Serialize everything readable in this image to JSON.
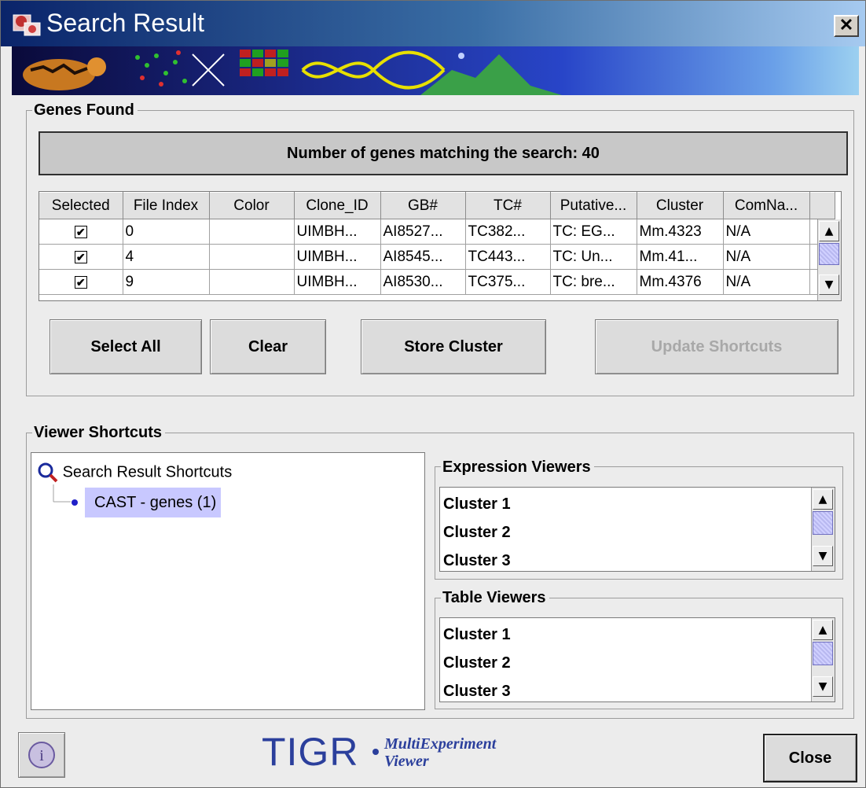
{
  "window": {
    "title": "Search Result",
    "close_glyph": "✕"
  },
  "genes_found": {
    "title": "Genes Found",
    "count_text": "Number of genes matching the search: 40",
    "columns": [
      "Selected",
      "File Index",
      "Color",
      "Clone_ID",
      "GB#",
      "TC#",
      "Putative...",
      "Cluster",
      "ComNa..."
    ],
    "rows": [
      {
        "selected": true,
        "file_index": "0",
        "color": "",
        "clone_id": "UIMBH...",
        "gb": "AI8527...",
        "tc": "TC382...",
        "putative": "TC: EG...",
        "cluster": "Mm.4323",
        "comname": "N/A"
      },
      {
        "selected": true,
        "file_index": "4",
        "color": "",
        "clone_id": "UIMBH...",
        "gb": "AI8545...",
        "tc": "TC443...",
        "putative": "TC: Un...",
        "cluster": "Mm.41...",
        "comname": "N/A"
      },
      {
        "selected": true,
        "file_index": "9",
        "color": "",
        "clone_id": "UIMBH...",
        "gb": "AI8530...",
        "tc": "TC375...",
        "putative": "TC: bre...",
        "cluster": "Mm.4376",
        "comname": "N/A"
      }
    ],
    "buttons": {
      "select_all": "Select All",
      "clear": "Clear",
      "store_cluster": "Store Cluster",
      "update_shortcuts": "Update Shortcuts"
    }
  },
  "viewer_shortcuts": {
    "title": "Viewer Shortcuts",
    "tree_root": "Search Result Shortcuts",
    "tree_node": "CAST - genes (1)",
    "expression_viewers": {
      "title": "Expression Viewers",
      "items": [
        "Cluster 1",
        "Cluster 2",
        "Cluster 3"
      ]
    },
    "table_viewers": {
      "title": "Table Viewers",
      "items": [
        "Cluster 1",
        "Cluster 2",
        "Cluster 3"
      ]
    }
  },
  "footer": {
    "logo_main": "TIGR",
    "logo_sub_1": "MultiExperiment",
    "logo_sub_2": "Viewer",
    "close_label": "Close"
  },
  "icons": {
    "checkmark": "✔",
    "up_arrow": "▲",
    "down_arrow": "▼"
  },
  "colors": {
    "titlebar_start": "#0a246a",
    "titlebar_end": "#a6caf0",
    "selection": "#c8c8ff",
    "logo": "#2b3f9c"
  }
}
